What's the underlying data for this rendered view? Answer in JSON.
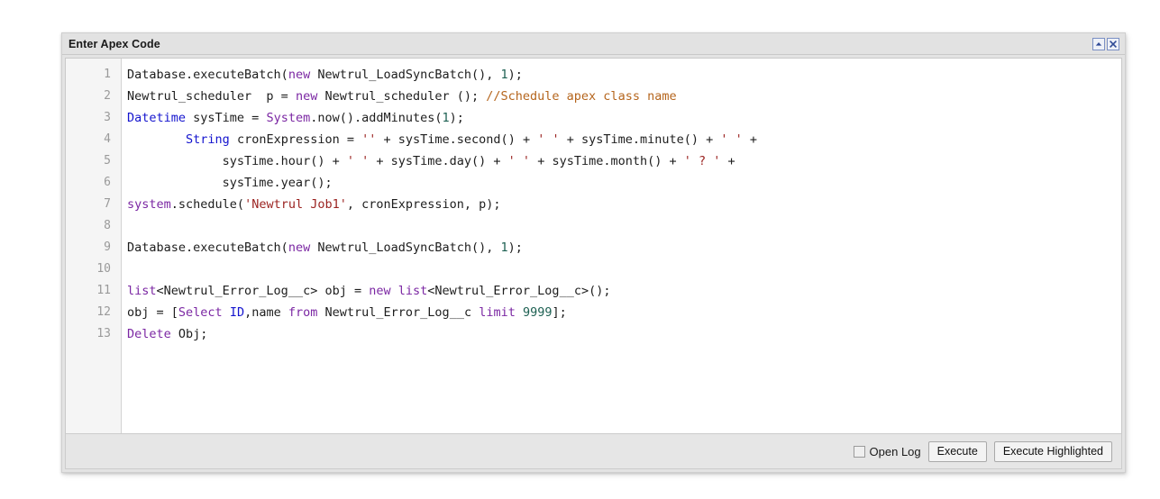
{
  "window": {
    "title": "Enter Apex Code",
    "controls": [
      {
        "name": "collapse-button",
        "icon": "triangle-up-icon"
      },
      {
        "name": "close-button",
        "icon": "close-x-icon"
      }
    ]
  },
  "editor": {
    "line_numbers": [
      "1",
      "2",
      "3",
      "4",
      "5",
      "6",
      "7",
      "8",
      "9",
      "10",
      "11",
      "12",
      "13"
    ],
    "lines": [
      {
        "number": "1",
        "tokens": [
          {
            "t": "Database.executeBatch(",
            "c": "pln"
          },
          {
            "t": "new",
            "c": "kw"
          },
          {
            "t": " Newtrul_LoadSyncBatch(), ",
            "c": "pln"
          },
          {
            "t": "1",
            "c": "num"
          },
          {
            "t": ");",
            "c": "pln"
          }
        ]
      },
      {
        "number": "2",
        "tokens": [
          {
            "t": "Newtrul_scheduler  p = ",
            "c": "pln"
          },
          {
            "t": "new",
            "c": "kw"
          },
          {
            "t": " Newtrul_scheduler (); ",
            "c": "pln"
          },
          {
            "t": "//Schedule apex class name",
            "c": "com"
          }
        ]
      },
      {
        "number": "3",
        "tokens": [
          {
            "t": "Datetime",
            "c": "type"
          },
          {
            "t": " sysTime = ",
            "c": "pln"
          },
          {
            "t": "System",
            "c": "kw"
          },
          {
            "t": ".now().addMinutes(",
            "c": "pln"
          },
          {
            "t": "1",
            "c": "num"
          },
          {
            "t": ");",
            "c": "pln"
          }
        ]
      },
      {
        "number": "4",
        "tokens": [
          {
            "t": "        ",
            "c": "pln"
          },
          {
            "t": "String",
            "c": "type"
          },
          {
            "t": " cronExpression = ",
            "c": "pln"
          },
          {
            "t": "''",
            "c": "str"
          },
          {
            "t": " + sysTime.second() + ",
            "c": "pln"
          },
          {
            "t": "' '",
            "c": "str"
          },
          {
            "t": " + sysTime.minute() + ",
            "c": "pln"
          },
          {
            "t": "' '",
            "c": "str"
          },
          {
            "t": " +",
            "c": "pln"
          }
        ]
      },
      {
        "number": "5",
        "tokens": [
          {
            "t": "             sysTime.hour() + ",
            "c": "pln"
          },
          {
            "t": "' '",
            "c": "str"
          },
          {
            "t": " + sysTime.day() + ",
            "c": "pln"
          },
          {
            "t": "' '",
            "c": "str"
          },
          {
            "t": " + sysTime.month() + ",
            "c": "pln"
          },
          {
            "t": "' ? '",
            "c": "str"
          },
          {
            "t": " +",
            "c": "pln"
          }
        ]
      },
      {
        "number": "6",
        "tokens": [
          {
            "t": "             sysTime.year();",
            "c": "pln"
          }
        ]
      },
      {
        "number": "7",
        "tokens": [
          {
            "t": "system",
            "c": "kw"
          },
          {
            "t": ".schedule(",
            "c": "pln"
          },
          {
            "t": "'Newtrul Job1'",
            "c": "str"
          },
          {
            "t": ", cronExpression, p);",
            "c": "pln"
          }
        ]
      },
      {
        "number": "8",
        "tokens": [
          {
            "t": "",
            "c": "pln"
          }
        ]
      },
      {
        "number": "9",
        "tokens": [
          {
            "t": "Database.executeBatch(",
            "c": "pln"
          },
          {
            "t": "new",
            "c": "kw"
          },
          {
            "t": " Newtrul_LoadSyncBatch(), ",
            "c": "pln"
          },
          {
            "t": "1",
            "c": "num"
          },
          {
            "t": ");",
            "c": "pln"
          }
        ]
      },
      {
        "number": "10",
        "tokens": [
          {
            "t": "",
            "c": "pln"
          }
        ]
      },
      {
        "number": "11",
        "tokens": [
          {
            "t": "list",
            "c": "kw"
          },
          {
            "t": "<Newtrul_Error_Log__c> obj = ",
            "c": "pln"
          },
          {
            "t": "new",
            "c": "kw"
          },
          {
            "t": " ",
            "c": "pln"
          },
          {
            "t": "list",
            "c": "kw"
          },
          {
            "t": "<Newtrul_Error_Log__c>();",
            "c": "pln"
          }
        ]
      },
      {
        "number": "12",
        "tokens": [
          {
            "t": "obj = [",
            "c": "pln"
          },
          {
            "t": "Select",
            "c": "kw"
          },
          {
            "t": " ",
            "c": "pln"
          },
          {
            "t": "ID",
            "c": "type"
          },
          {
            "t": ",name ",
            "c": "pln"
          },
          {
            "t": "from",
            "c": "kw"
          },
          {
            "t": " Newtrul_Error_Log__c ",
            "c": "pln"
          },
          {
            "t": "limit",
            "c": "kw"
          },
          {
            "t": " ",
            "c": "pln"
          },
          {
            "t": "9999",
            "c": "num"
          },
          {
            "t": "];",
            "c": "pln"
          }
        ]
      },
      {
        "number": "13",
        "tokens": [
          {
            "t": "Delete",
            "c": "kw"
          },
          {
            "t": " Obj;",
            "c": "pln"
          }
        ]
      }
    ]
  },
  "footer": {
    "open_log_label": "Open Log",
    "open_log_checked": false,
    "execute_label": "Execute",
    "execute_highlighted_label": "Execute Highlighted"
  },
  "colors": {
    "keyword": "#7b27a3",
    "type": "#1414ce",
    "string": "#9b2321",
    "comment": "#b5651d",
    "number": "#1d6052",
    "plain": "#1d1d1d",
    "gutter_bg": "#f5f5f5",
    "titlebar_bg": "#e2e2e2",
    "footer_bg": "#e6e6e6"
  }
}
